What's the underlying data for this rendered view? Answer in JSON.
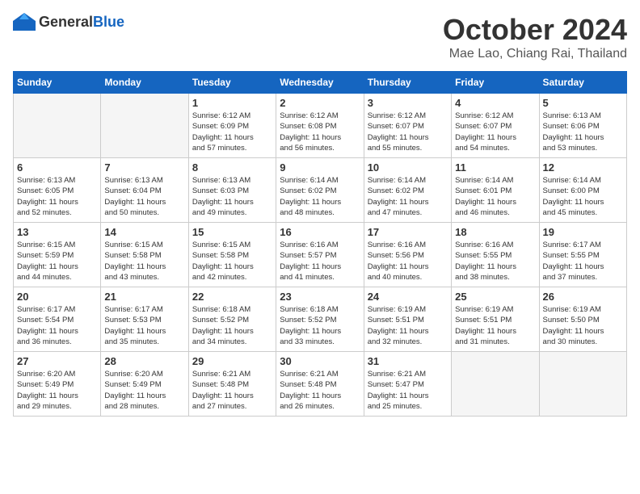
{
  "header": {
    "logo_general": "General",
    "logo_blue": "Blue",
    "month": "October 2024",
    "location": "Mae Lao, Chiang Rai, Thailand"
  },
  "days_of_week": [
    "Sunday",
    "Monday",
    "Tuesday",
    "Wednesday",
    "Thursday",
    "Friday",
    "Saturday"
  ],
  "weeks": [
    [
      {
        "day": "",
        "info": ""
      },
      {
        "day": "",
        "info": ""
      },
      {
        "day": "1",
        "info": "Sunrise: 6:12 AM\nSunset: 6:09 PM\nDaylight: 11 hours\nand 57 minutes."
      },
      {
        "day": "2",
        "info": "Sunrise: 6:12 AM\nSunset: 6:08 PM\nDaylight: 11 hours\nand 56 minutes."
      },
      {
        "day": "3",
        "info": "Sunrise: 6:12 AM\nSunset: 6:07 PM\nDaylight: 11 hours\nand 55 minutes."
      },
      {
        "day": "4",
        "info": "Sunrise: 6:12 AM\nSunset: 6:07 PM\nDaylight: 11 hours\nand 54 minutes."
      },
      {
        "day": "5",
        "info": "Sunrise: 6:13 AM\nSunset: 6:06 PM\nDaylight: 11 hours\nand 53 minutes."
      }
    ],
    [
      {
        "day": "6",
        "info": "Sunrise: 6:13 AM\nSunset: 6:05 PM\nDaylight: 11 hours\nand 52 minutes."
      },
      {
        "day": "7",
        "info": "Sunrise: 6:13 AM\nSunset: 6:04 PM\nDaylight: 11 hours\nand 50 minutes."
      },
      {
        "day": "8",
        "info": "Sunrise: 6:13 AM\nSunset: 6:03 PM\nDaylight: 11 hours\nand 49 minutes."
      },
      {
        "day": "9",
        "info": "Sunrise: 6:14 AM\nSunset: 6:02 PM\nDaylight: 11 hours\nand 48 minutes."
      },
      {
        "day": "10",
        "info": "Sunrise: 6:14 AM\nSunset: 6:02 PM\nDaylight: 11 hours\nand 47 minutes."
      },
      {
        "day": "11",
        "info": "Sunrise: 6:14 AM\nSunset: 6:01 PM\nDaylight: 11 hours\nand 46 minutes."
      },
      {
        "day": "12",
        "info": "Sunrise: 6:14 AM\nSunset: 6:00 PM\nDaylight: 11 hours\nand 45 minutes."
      }
    ],
    [
      {
        "day": "13",
        "info": "Sunrise: 6:15 AM\nSunset: 5:59 PM\nDaylight: 11 hours\nand 44 minutes."
      },
      {
        "day": "14",
        "info": "Sunrise: 6:15 AM\nSunset: 5:58 PM\nDaylight: 11 hours\nand 43 minutes."
      },
      {
        "day": "15",
        "info": "Sunrise: 6:15 AM\nSunset: 5:58 PM\nDaylight: 11 hours\nand 42 minutes."
      },
      {
        "day": "16",
        "info": "Sunrise: 6:16 AM\nSunset: 5:57 PM\nDaylight: 11 hours\nand 41 minutes."
      },
      {
        "day": "17",
        "info": "Sunrise: 6:16 AM\nSunset: 5:56 PM\nDaylight: 11 hours\nand 40 minutes."
      },
      {
        "day": "18",
        "info": "Sunrise: 6:16 AM\nSunset: 5:55 PM\nDaylight: 11 hours\nand 38 minutes."
      },
      {
        "day": "19",
        "info": "Sunrise: 6:17 AM\nSunset: 5:55 PM\nDaylight: 11 hours\nand 37 minutes."
      }
    ],
    [
      {
        "day": "20",
        "info": "Sunrise: 6:17 AM\nSunset: 5:54 PM\nDaylight: 11 hours\nand 36 minutes."
      },
      {
        "day": "21",
        "info": "Sunrise: 6:17 AM\nSunset: 5:53 PM\nDaylight: 11 hours\nand 35 minutes."
      },
      {
        "day": "22",
        "info": "Sunrise: 6:18 AM\nSunset: 5:52 PM\nDaylight: 11 hours\nand 34 minutes."
      },
      {
        "day": "23",
        "info": "Sunrise: 6:18 AM\nSunset: 5:52 PM\nDaylight: 11 hours\nand 33 minutes."
      },
      {
        "day": "24",
        "info": "Sunrise: 6:19 AM\nSunset: 5:51 PM\nDaylight: 11 hours\nand 32 minutes."
      },
      {
        "day": "25",
        "info": "Sunrise: 6:19 AM\nSunset: 5:51 PM\nDaylight: 11 hours\nand 31 minutes."
      },
      {
        "day": "26",
        "info": "Sunrise: 6:19 AM\nSunset: 5:50 PM\nDaylight: 11 hours\nand 30 minutes."
      }
    ],
    [
      {
        "day": "27",
        "info": "Sunrise: 6:20 AM\nSunset: 5:49 PM\nDaylight: 11 hours\nand 29 minutes."
      },
      {
        "day": "28",
        "info": "Sunrise: 6:20 AM\nSunset: 5:49 PM\nDaylight: 11 hours\nand 28 minutes."
      },
      {
        "day": "29",
        "info": "Sunrise: 6:21 AM\nSunset: 5:48 PM\nDaylight: 11 hours\nand 27 minutes."
      },
      {
        "day": "30",
        "info": "Sunrise: 6:21 AM\nSunset: 5:48 PM\nDaylight: 11 hours\nand 26 minutes."
      },
      {
        "day": "31",
        "info": "Sunrise: 6:21 AM\nSunset: 5:47 PM\nDaylight: 11 hours\nand 25 minutes."
      },
      {
        "day": "",
        "info": ""
      },
      {
        "day": "",
        "info": ""
      }
    ]
  ]
}
